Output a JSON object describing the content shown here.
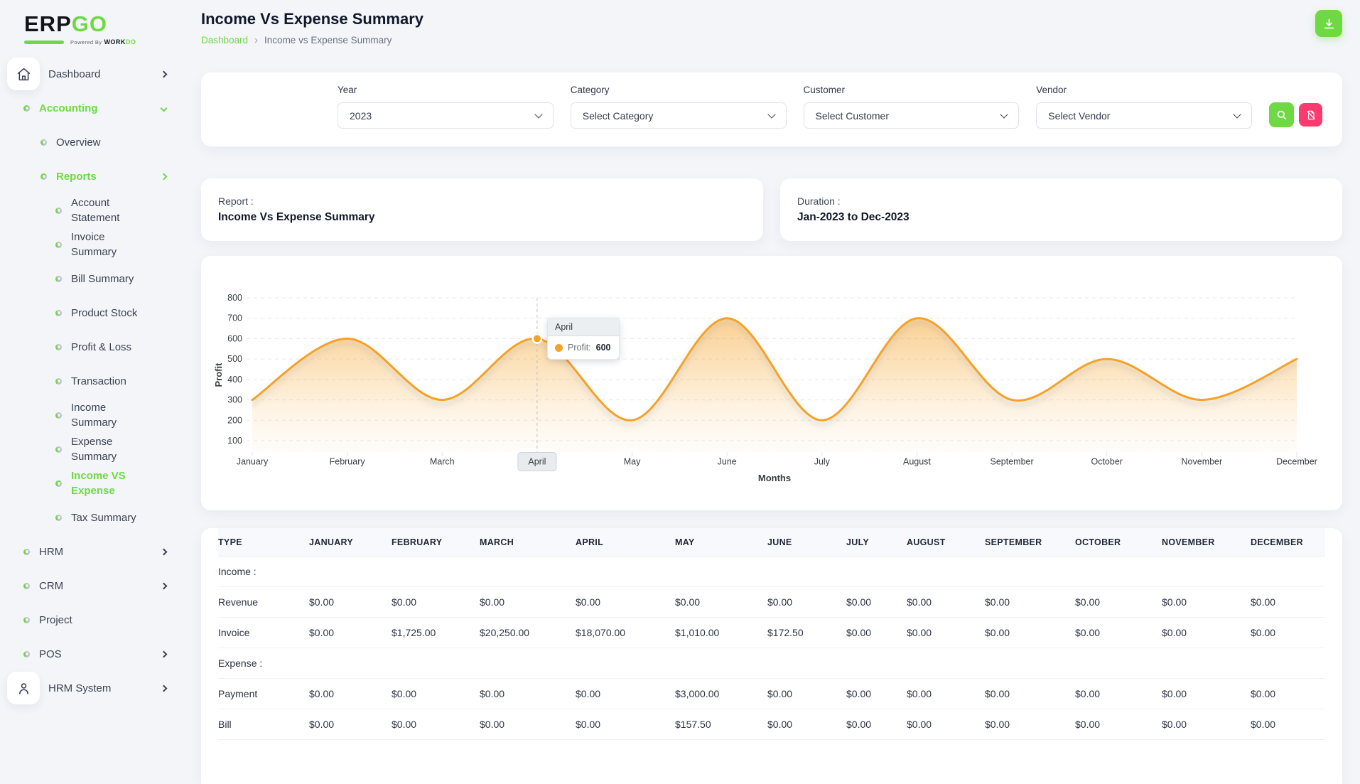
{
  "colors": {
    "accent_green": "#6fd943",
    "danger_pink": "#ff3a6e",
    "chart_orange": "#f5a228"
  },
  "brand": {
    "name_part1": "ERP",
    "name_part2": "GO",
    "powered_by": "Powered By",
    "workdo_part1": "WORK",
    "workdo_part2": "DO"
  },
  "sidebar": {
    "items": [
      {
        "label": "Dashboard",
        "level": 0,
        "icon": "home",
        "chevron": "right"
      },
      {
        "label": "Accounting",
        "level": 0,
        "icon": "dot",
        "chevron": "down",
        "active": true
      },
      {
        "label": "Overview",
        "level": 1,
        "icon": "dot"
      },
      {
        "label": "Reports",
        "level": 1,
        "icon": "dot",
        "chevron": "right",
        "active": true
      },
      {
        "label": "Account Statement",
        "level": 2,
        "icon": "dot"
      },
      {
        "label": "Invoice Summary",
        "level": 2,
        "icon": "dot"
      },
      {
        "label": "Bill Summary",
        "level": 2,
        "icon": "dot"
      },
      {
        "label": "Product Stock",
        "level": 2,
        "icon": "dot"
      },
      {
        "label": "Profit & Loss",
        "level": 2,
        "icon": "dot"
      },
      {
        "label": "Transaction",
        "level": 2,
        "icon": "dot"
      },
      {
        "label": "Income Summary",
        "level": 2,
        "icon": "dot"
      },
      {
        "label": "Expense Summary",
        "level": 2,
        "icon": "dot"
      },
      {
        "label": "Income VS Expense",
        "level": 2,
        "icon": "dot",
        "active": true
      },
      {
        "label": "Tax Summary",
        "level": 2,
        "icon": "dot"
      },
      {
        "label": "HRM",
        "level": 0,
        "icon": "dot",
        "chevron": "right"
      },
      {
        "label": "CRM",
        "level": 0,
        "icon": "dot",
        "chevron": "right"
      },
      {
        "label": "Project",
        "level": 0,
        "icon": "dot"
      },
      {
        "label": "POS",
        "level": 0,
        "icon": "dot",
        "chevron": "right"
      },
      {
        "label": "HRM System",
        "level": 0,
        "icon": "user",
        "chevron": "right"
      }
    ]
  },
  "header": {
    "title": "Income Vs Expense Summary",
    "breadcrumb_home": "Dashboard",
    "breadcrumb_separator": "›",
    "breadcrumb_current": "Income vs Expense Summary"
  },
  "filters": {
    "year": {
      "label": "Year",
      "value": "2023"
    },
    "category": {
      "label": "Category",
      "value": "Select Category"
    },
    "customer": {
      "label": "Customer",
      "value": "Select Customer"
    },
    "vendor": {
      "label": "Vendor",
      "value": "Select Vendor"
    }
  },
  "report_card": {
    "label": "Report :",
    "value": "Income Vs Expense Summary"
  },
  "duration_card": {
    "label": "Duration :",
    "value": "Jan-2023 to Dec-2023"
  },
  "chart_data": {
    "type": "area",
    "categories": [
      "January",
      "February",
      "March",
      "April",
      "May",
      "June",
      "July",
      "August",
      "September",
      "October",
      "November",
      "December"
    ],
    "series": [
      {
        "name": "Profit",
        "values": [
          300,
          600,
          300,
          600,
          200,
          700,
          200,
          700,
          300,
          500,
          300,
          500
        ]
      }
    ],
    "xlabel": "Months",
    "ylabel": "Profit",
    "ylim": [
      100,
      800
    ],
    "y_ticks": [
      800,
      700,
      600,
      500,
      400,
      300,
      200,
      100
    ],
    "grid": "dashed-horizontal",
    "line_color": "#f5a228",
    "curve": "smooth",
    "legend": "none",
    "highlight": {
      "category": "April",
      "value": 600
    }
  },
  "chart_tooltip": {
    "title": "April",
    "series_label": "Profit:",
    "value": "600"
  },
  "table": {
    "columns": [
      "TYPE",
      "JANUARY",
      "FEBRUARY",
      "MARCH",
      "APRIL",
      "MAY",
      "JUNE",
      "JULY",
      "AUGUST",
      "SEPTEMBER",
      "OCTOBER",
      "NOVEMBER",
      "DECEMBER"
    ],
    "sections": [
      {
        "label": "Income :",
        "rows": [
          {
            "type": "Revenue",
            "values": [
              "$0.00",
              "$0.00",
              "$0.00",
              "$0.00",
              "$0.00",
              "$0.00",
              "$0.00",
              "$0.00",
              "$0.00",
              "$0.00",
              "$0.00",
              "$0.00"
            ]
          },
          {
            "type": "Invoice",
            "values": [
              "$0.00",
              "$1,725.00",
              "$20,250.00",
              "$18,070.00",
              "$1,010.00",
              "$172.50",
              "$0.00",
              "$0.00",
              "$0.00",
              "$0.00",
              "$0.00",
              "$0.00"
            ]
          }
        ]
      },
      {
        "label": "Expense :",
        "rows": [
          {
            "type": "Payment",
            "values": [
              "$0.00",
              "$0.00",
              "$0.00",
              "$0.00",
              "$3,000.00",
              "$0.00",
              "$0.00",
              "$0.00",
              "$0.00",
              "$0.00",
              "$0.00",
              "$0.00"
            ]
          },
          {
            "type": "Bill",
            "values": [
              "$0.00",
              "$0.00",
              "$0.00",
              "$0.00",
              "$157.50",
              "$0.00",
              "$0.00",
              "$0.00",
              "$0.00",
              "$0.00",
              "$0.00",
              "$0.00"
            ]
          }
        ]
      }
    ]
  }
}
